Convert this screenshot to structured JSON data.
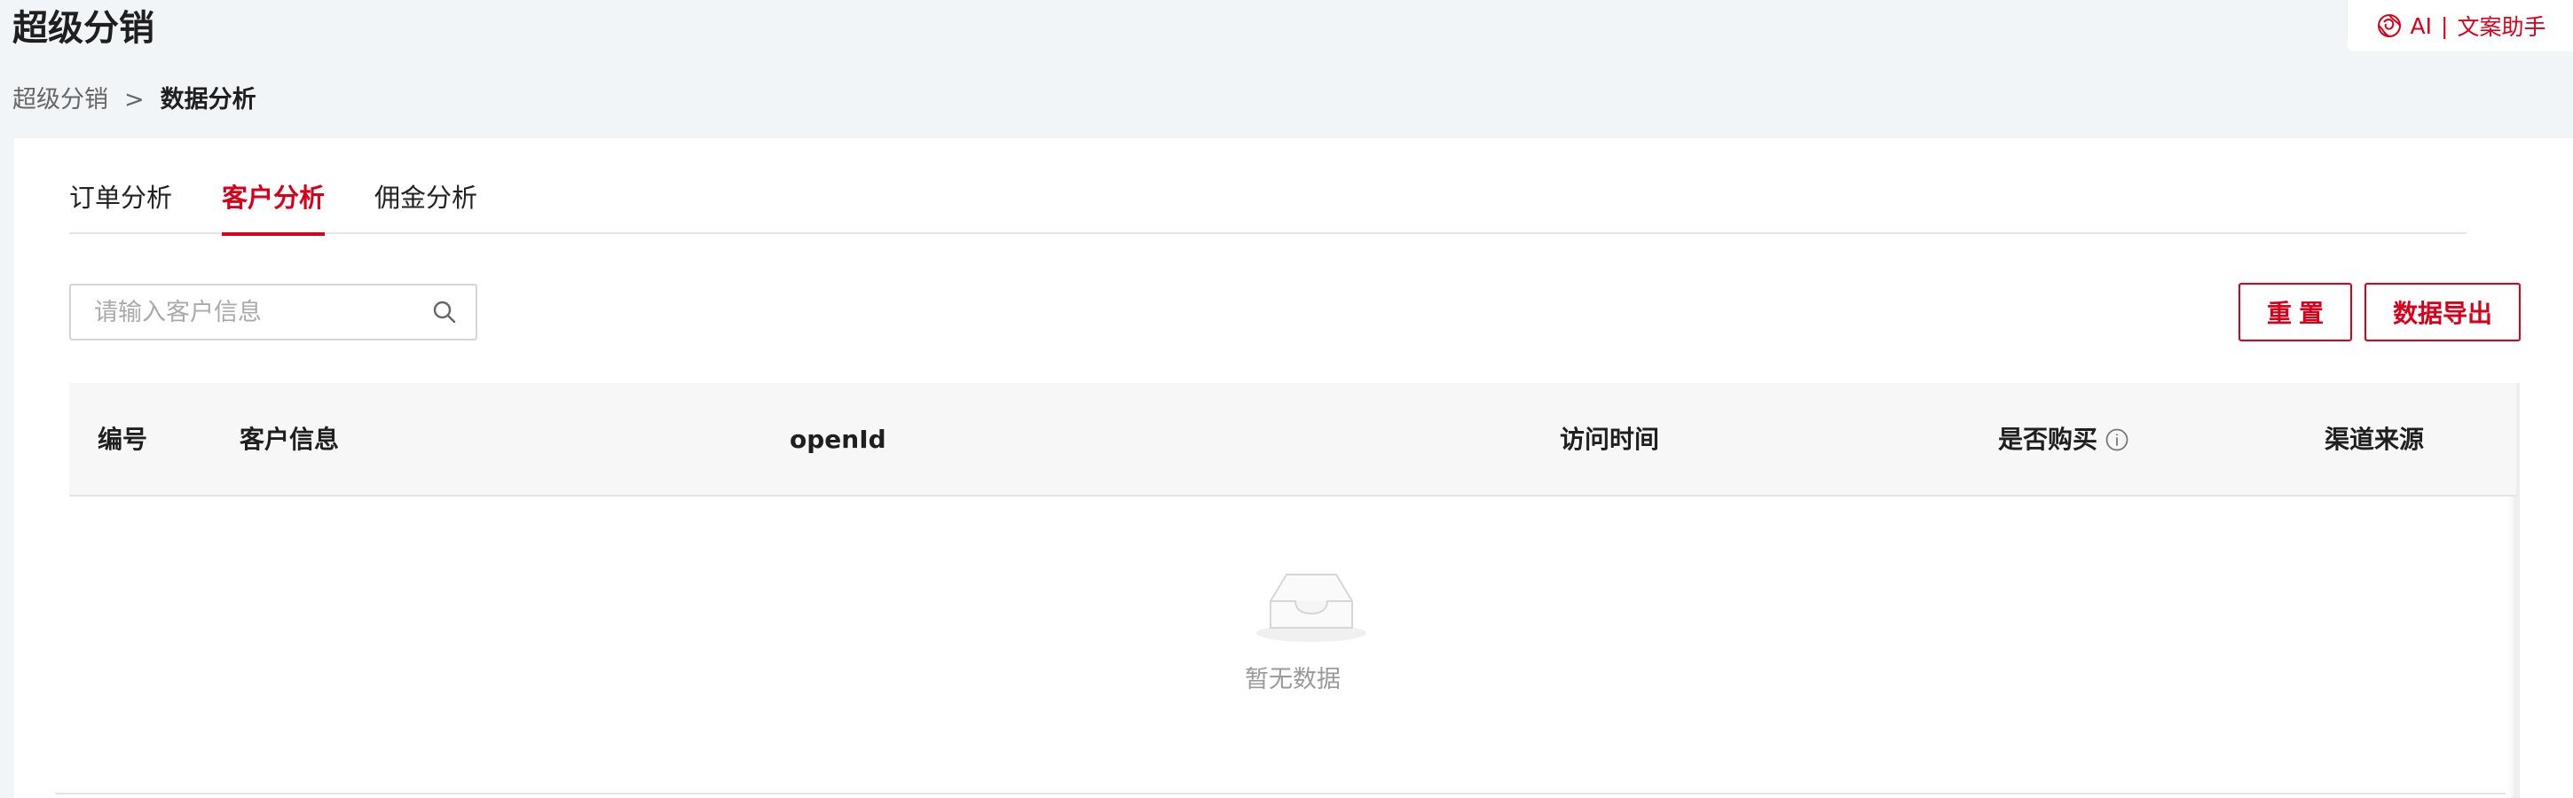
{
  "header": {
    "title": "超级分销",
    "ai_helper": {
      "label_ai": "AI",
      "separator": "|",
      "label_text": "文案助手",
      "icon": "ai-swirl-icon"
    }
  },
  "breadcrumb": {
    "parent": "超级分销",
    "separator": ">",
    "current": "数据分析"
  },
  "tabs": [
    {
      "label": "订单分析",
      "active": false
    },
    {
      "label": "客户分析",
      "active": true
    },
    {
      "label": "佣金分析",
      "active": false
    }
  ],
  "search": {
    "placeholder": "请输入客户信息",
    "value": "",
    "icon": "search-icon"
  },
  "buttons": {
    "reset": "重置",
    "export": "数据导出"
  },
  "table": {
    "columns": [
      "编号",
      "客户信息",
      "openId",
      "访问时间",
      "是否购买",
      "渠道来源"
    ],
    "rows": [],
    "empty_text": "暂无数据"
  },
  "colors": {
    "accent": "#d9001b",
    "background": "#f2f5f8"
  }
}
